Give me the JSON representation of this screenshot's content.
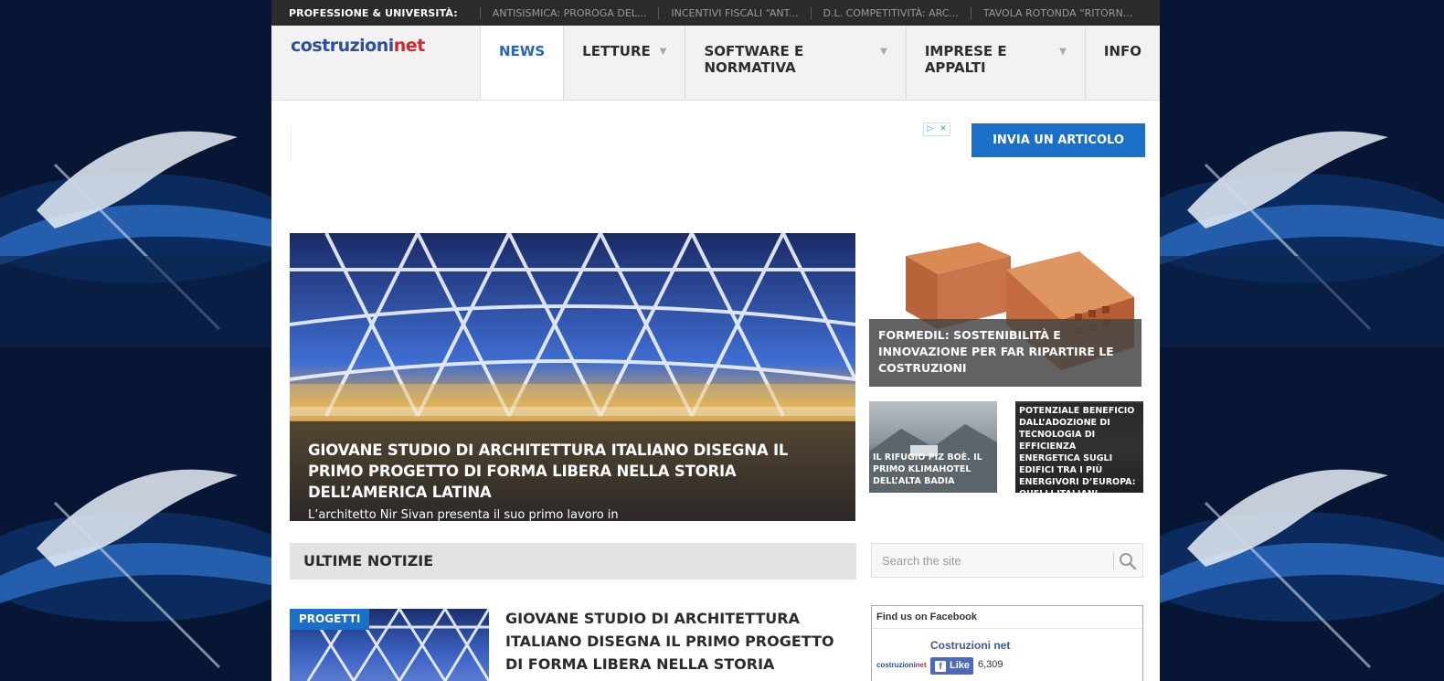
{
  "ticker": {
    "label": "PROFESSIONE & UNIVERSITÀ:",
    "items": [
      "ANTISISMICA: PROROGA DEL...",
      "INCENTIVI FISCALI “ANT...",
      "D.L. COMPETITIVITÀ: ARC...",
      "TAVOLA ROTONDA “RITORN..."
    ]
  },
  "header": {
    "logo_main": "costruzioni",
    "logo_accent": "net",
    "nav": [
      {
        "label": "NEWS",
        "active": true,
        "has_arrow": false
      },
      {
        "label": "LETTURE",
        "active": false,
        "has_arrow": true
      },
      {
        "label": "SOFTWARE E NORMATIVA",
        "active": false,
        "has_arrow": true
      },
      {
        "label": "IMPRESE E APPALTI",
        "active": false,
        "has_arrow": true
      },
      {
        "label": "INFO",
        "active": false,
        "has_arrow": false
      }
    ],
    "arrow_glyph": "▼"
  },
  "ad": {
    "choices_play": "▷",
    "choices_close": "✕",
    "submit_button": "INVIA UN ARTICOLO"
  },
  "featured": {
    "title": "GIOVANE STUDIO DI ARCHITETTURA ITALIANO DISEGNA IL PRIMO PROGETTO DI FORMA LIBERA NELLA STORIA DELL’AMERICA LATINA",
    "subtitle": "L’architetto Nir Sivan presenta il suo primo lavoro in",
    "side_big": "FORMEDIL: SOSTENIBILITÀ E INNOVAZIONE PER FAR RIPARTIRE LE COSTRUZIONI",
    "side_small_1": "IL RIFUGIO PIZ BOÈ. IL PRIMO KLIMAHOTEL DELL’ALTA BADIA",
    "side_small_2": "POTENZIALE BENEFICIO DALL’ADOZIONE DI TECNOLOGIA DI EFFICIENZA ENERGETICA SUGLI EDIFICI TRA I PIÙ ENERGIVORI D’EUROPA: QUELLI ITALIANI"
  },
  "latest": {
    "section_title": "ULTIME NOTIZIE",
    "article": {
      "tag": "PROGETTI",
      "title": "GIOVANE STUDIO DI ARCHITETTURA ITALIANO DISEGNA IL PRIMO PROGETTO DI FORMA LIBERA NELLA STORIA DELL’AMERICA LATINA"
    }
  },
  "search": {
    "placeholder": "Search the site",
    "icon": "search-icon"
  },
  "facebook": {
    "header": "Find us on Facebook",
    "page_name": "Costruzioni net",
    "like_label": "Like",
    "like_f": "f",
    "count": "6,309",
    "logo_main": "costruzioni",
    "logo_accent": "net"
  },
  "colors": {
    "accent_blue": "#1a6fc9",
    "nav_active": "#2a65b3",
    "logo_blue": "#2a4f9c",
    "logo_red": "#d4262f",
    "ticker_bg": "#2b2b2b"
  }
}
